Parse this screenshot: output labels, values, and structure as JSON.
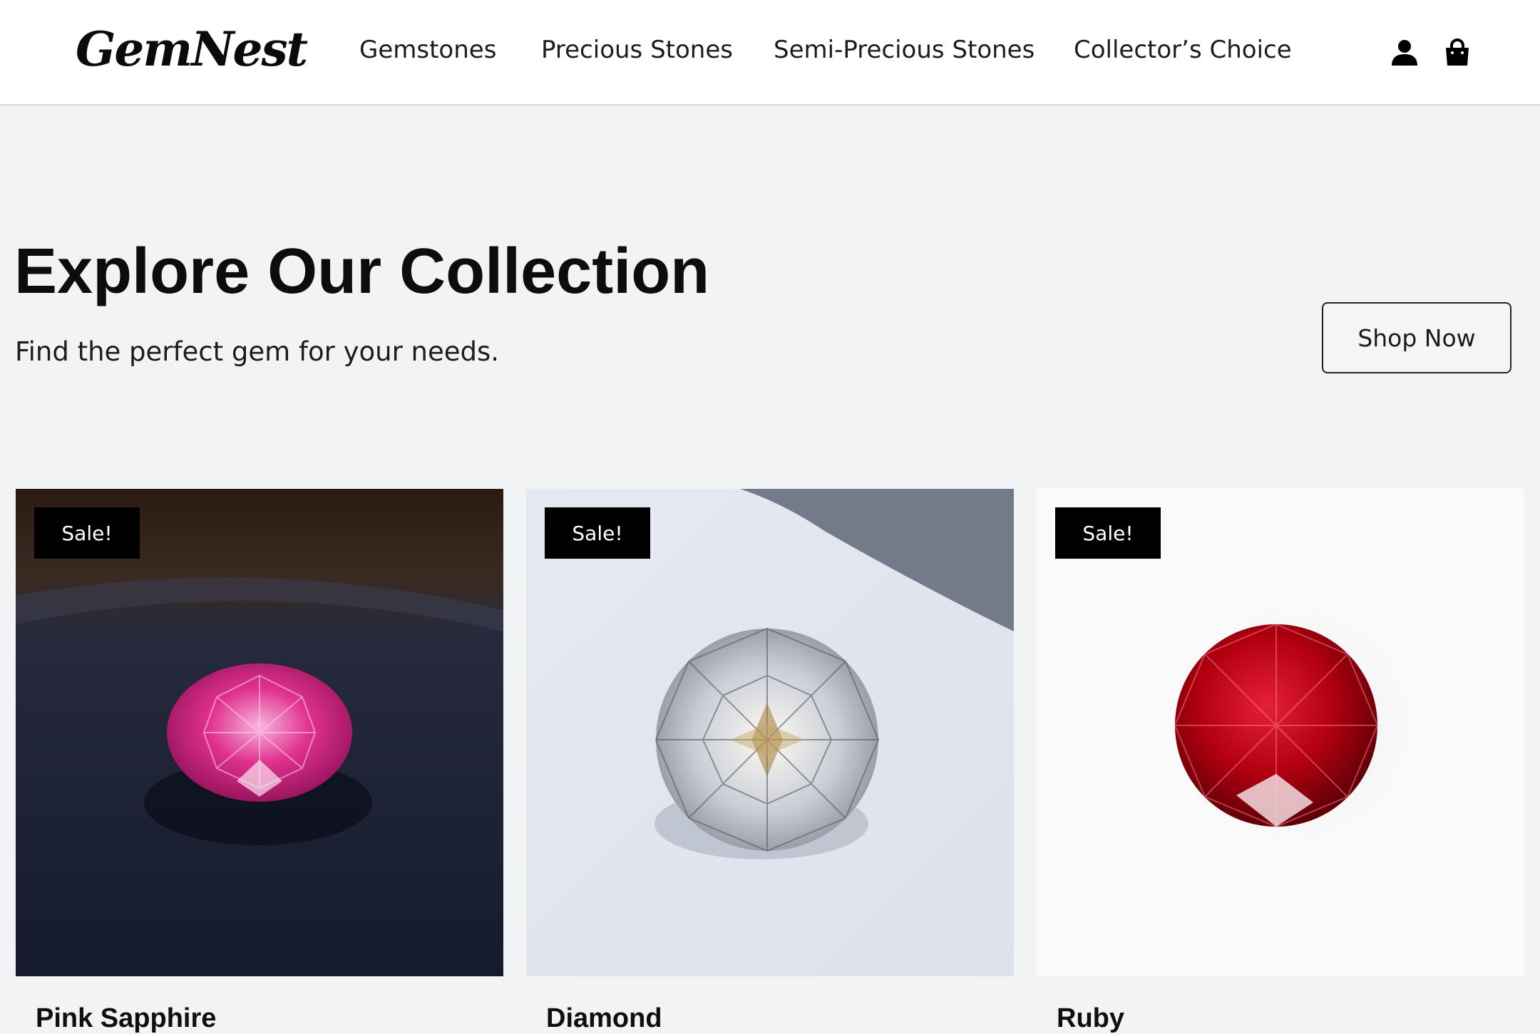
{
  "brand": {
    "logo_text": "GemNest"
  },
  "nav": {
    "items": [
      {
        "label": "Gemstones"
      },
      {
        "label": "Precious Stones"
      },
      {
        "label": "Semi-Precious Stones"
      },
      {
        "label": "Collector’s Choice"
      }
    ]
  },
  "header_icons": {
    "account": "user-icon",
    "cart": "shopping-bag-icon"
  },
  "hero": {
    "title": "Explore Our Collection",
    "subtitle": "Find the perfect gem for your needs.",
    "cta_label": "Shop Now"
  },
  "products": [
    {
      "name": "Pink Sapphire",
      "badge": "Sale!"
    },
    {
      "name": "Diamond",
      "badge": "Sale!"
    },
    {
      "name": "Ruby",
      "badge": "Sale!"
    }
  ],
  "colors": {
    "page_bg": "#f2f3f5",
    "header_bg": "#ffffff",
    "badge_bg": "#000000",
    "badge_text": "#ffffff",
    "text": "#111111",
    "pink_sapphire": "#e0328f",
    "ruby": "#b3000f"
  }
}
